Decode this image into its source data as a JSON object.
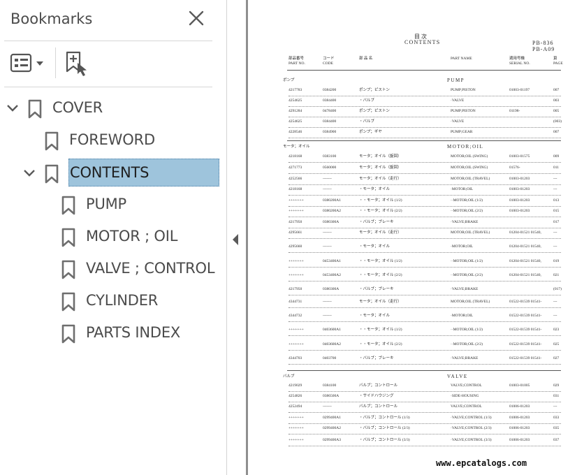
{
  "panel": {
    "title": "Bookmarks",
    "close_icon": "close-icon",
    "options_icon": "bookmark-options-icon",
    "new_bookmark_icon": "new-bookmark-icon"
  },
  "bookmarks": [
    {
      "label": "COVER",
      "level": 0,
      "expanded": true,
      "selected": false
    },
    {
      "label": "FOREWORD",
      "level": 1,
      "expanded": null,
      "selected": false
    },
    {
      "label": "CONTENTS",
      "level": 1,
      "expanded": true,
      "selected": true
    },
    {
      "label": "PUMP",
      "level": 2,
      "expanded": null,
      "selected": false
    },
    {
      "label": "MOTOR ; OIL",
      "level": 2,
      "expanded": null,
      "selected": false
    },
    {
      "label": "VALVE ; CONTROL",
      "level": 2,
      "expanded": null,
      "selected": false
    },
    {
      "label": "CYLINDER",
      "level": 2,
      "expanded": null,
      "selected": false
    },
    {
      "label": "PARTS INDEX",
      "level": 2,
      "expanded": null,
      "selected": false
    }
  ],
  "colors": {
    "selection": "#9ec4dc",
    "icon": "#6e6e6e",
    "divider": "#8f8f8f"
  },
  "document": {
    "jp_title": "目 次",
    "title": "CONTENTS",
    "code1": "PB-836",
    "code2": "PB-A09",
    "headers": {
      "part_no_jp": "部品番号",
      "part_no": "PART NO.",
      "code_jp": "コード",
      "code": "CODE",
      "name_jp": "部 品 名",
      "part_name": "PART NAME",
      "serial_jp": "適用号機",
      "serial": "SERIAL NO.",
      "page_jp": "頁",
      "page": "PAGE"
    },
    "sections": [
      {
        "jp": "ポンプ",
        "en": "PUMP",
        "rows": [
          [
            "4217783",
            "0384200",
            "ポンプ；ピストン",
            "PUMP;PISTON",
            "01003-01197",
            "007"
          ],
          [
            "4254625",
            "0384400",
            "・バルブ",
            "·VALVE",
            "",
            "003"
          ],
          [
            "4291284",
            "0478400",
            "ポンプ；ピストン",
            "PUMP;PISTON",
            "01198-",
            "005"
          ],
          [
            "4254625",
            "0384400",
            "・バルブ",
            "·VALVE",
            "",
            "(003)"
          ],
          [
            "4228546",
            "0384900",
            "ポンプ；ギヤ",
            "PUMP;GEAR",
            "",
            "007"
          ]
        ]
      },
      {
        "jp": "モータ；オイル",
        "en": "MOTOR;OIL",
        "rows": [
          [
            "4218168",
            "0383100",
            "モータ；オイル（旋回）",
            "MOTOR;OIL (SWING)",
            "01003-01575",
            "009"
          ],
          [
            "4271773",
            "0560000",
            "モータ；オイル（旋回）",
            "MOTOR;OIL (SWING)",
            "01576-",
            "011"
          ],
          [
            "4252566",
            "-------",
            "モータ；オイル（走行）",
            "MOTOR;OIL (TRAVEL)",
            "01003-01203",
            "---"
          ],
          [
            "4218168",
            "-------",
            "・モータ；オイル",
            "·MOTOR;OIL",
            "01003-01203",
            "---"
          ],
          [
            "+++++++",
            "0380200A1",
            "・・モータ；オイル (1/2)",
            "··MOTOR;OIL (1/2)",
            "01003-01203",
            "013"
          ],
          [
            "+++++++",
            "0380200A2",
            "・・モータ；オイル (2/2)",
            "··MOTOR;OIL (2/2)",
            "01003-01203",
            "015"
          ],
          [
            "4217950",
            "0380300A",
            "・バルブ；ブレーキ",
            "·VALVE;BRAKE",
            "",
            "017"
          ],
          [
            "4295661",
            "-------",
            "モータ；オイル（走行）",
            "MOTOR;OIL (TRAVEL)",
            "01204-01521 01540,",
            "---"
          ],
          [
            "4295660",
            "-------",
            "・モータ；オイル",
            "·MOTOR;OIL",
            "01204-01521 01540,",
            "---"
          ],
          [
            "+++++++",
            "0453400A1",
            "・・モータ；オイル (1/2)",
            "··MOTOR;OIL (1/2)",
            "01204-01521 01540,",
            "019"
          ],
          [
            "+++++++",
            "0453400A2",
            "・・モータ；オイル (2/2)",
            "··MOTOR;OIL (2/2)",
            "01204-01521 01540,",
            "021"
          ],
          [
            "4217950",
            "0380300A",
            "・バルブ；ブレーキ",
            "·VALVE;BRAKE",
            "",
            "(017)"
          ],
          [
            "4344731",
            "-------",
            "モータ；オイル（走行）",
            "MOTOR;OIL (TRAVEL)",
            "01522-01539 01541-",
            "---"
          ],
          [
            "4344732",
            "-------",
            "・モータ；オイル",
            "·MOTOR;OIL",
            "01522-01539 01541-",
            "---"
          ],
          [
            "+++++++",
            "0403600A1",
            "・・モータ；オイル (1/2)",
            "··MOTOR;OIL (1/2)",
            "01522-01539 01541-",
            "023"
          ],
          [
            "+++++++",
            "0403600A2",
            "・・モータ；オイル (2/2)",
            "··MOTOR;OIL (2/2)",
            "01522-01539 01541-",
            "025"
          ],
          [
            "4344703",
            "0403700",
            "・バルブ；ブレーキ",
            "·VALVE;BRAKE",
            "01522-01539 01541-",
            "027"
          ]
        ]
      },
      {
        "jp": "バルブ",
        "en": "VALVE",
        "rows": [
          [
            "4219029",
            "0384100",
            "バルブ；コントロール",
            "VALVE;CONTROL",
            "01003-01005",
            "029"
          ],
          [
            "4254826",
            "0386500A",
            "・サイドハウジング",
            "·SIDE-HOUSING",
            "",
            "031"
          ],
          [
            "4252494",
            "-------",
            "バルブ；コントロール",
            "VALVE;CONTROL",
            "01006-01203",
            "---"
          ],
          [
            "+++++++",
            "0299400A1",
            "・バルブ；コントロール (1/3)",
            "·VALVE;CONTROL (1/3)",
            "01006-01203",
            "033"
          ],
          [
            "+++++++",
            "0299400A2",
            "・バルブ；コントロール (2/3)",
            "·VALVE;CONTROL (2/3)",
            "01006-01203",
            "035"
          ],
          [
            "+++++++",
            "0299400A3",
            "・バルブ；コントロール (3/3)",
            "·VALVE;CONTROL (3/3)",
            "01006-01203",
            "037"
          ]
        ]
      }
    ],
    "watermark": "www.epcatalogs.com"
  }
}
